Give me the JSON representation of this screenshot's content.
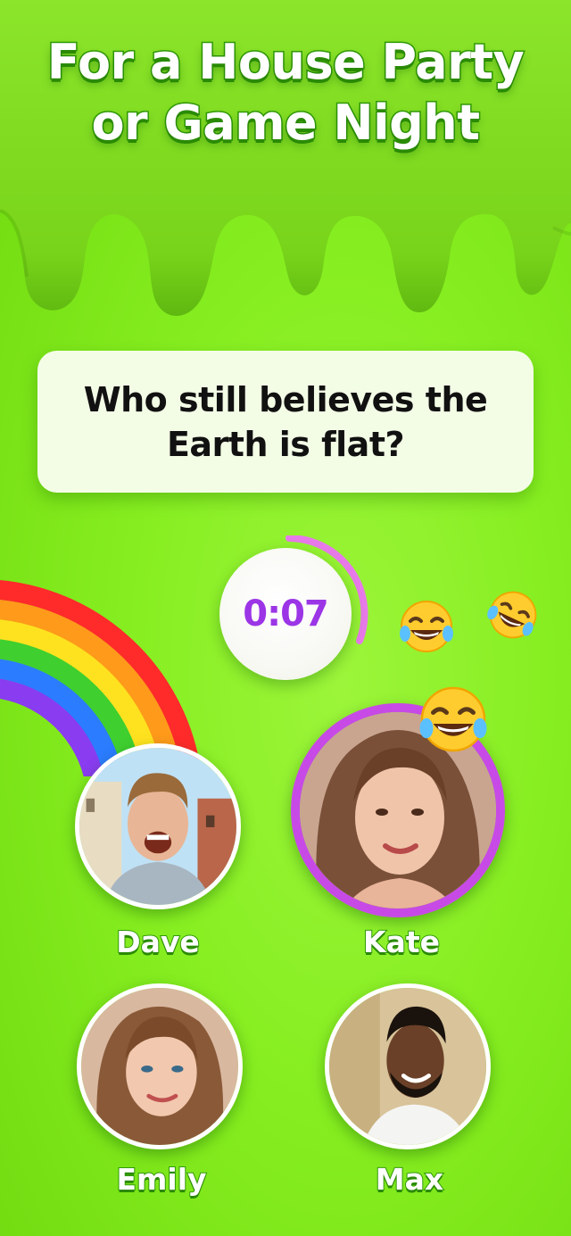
{
  "headline": {
    "line1": "For a House Party",
    "line2": "or Game Night"
  },
  "question": {
    "line1": "Who still believes the",
    "line2": "Earth is flat?"
  },
  "timer": {
    "value": "0:07",
    "remaining_fraction": 0.35
  },
  "players": [
    {
      "name": "Dave",
      "speaking": false
    },
    {
      "name": "Kate",
      "speaking": true
    },
    {
      "name": "Emily",
      "speaking": false
    },
    {
      "name": "Max",
      "speaking": false
    }
  ],
  "reactions": [
    "laughing-emoji",
    "laughing-emoji",
    "laughing-emoji"
  ],
  "colors": {
    "background": "#86ee20",
    "timer_text": "#9b35e6",
    "active_ring": "#c74ae6",
    "card": "#f3fde6"
  }
}
